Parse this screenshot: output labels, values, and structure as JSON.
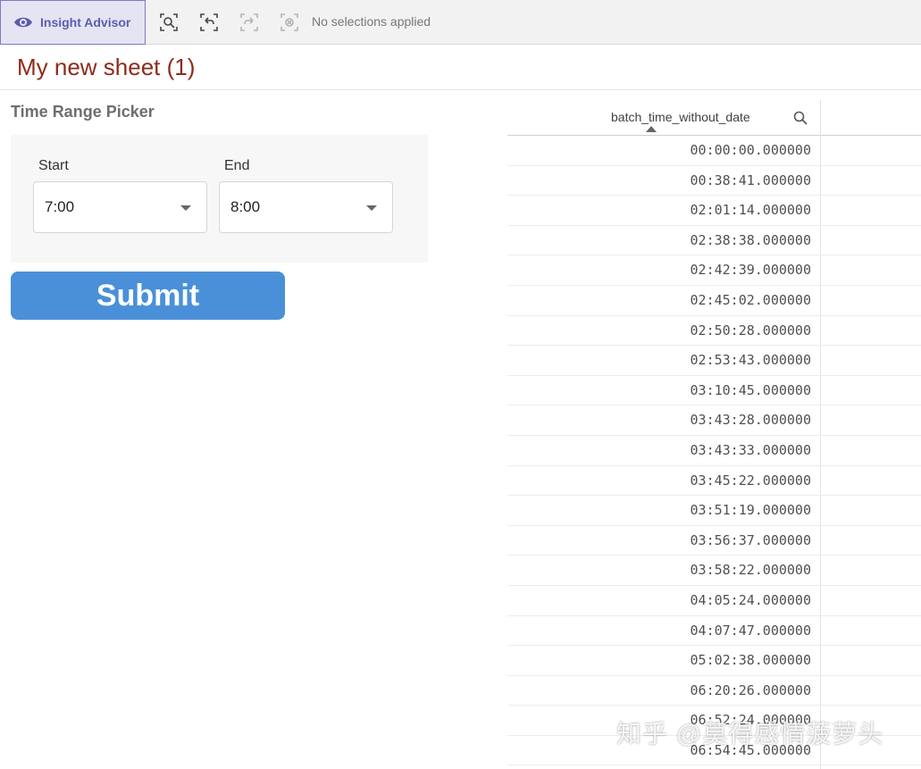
{
  "toolbar": {
    "insight_label": "Insight Advisor",
    "selection_status": "No selections applied"
  },
  "sheet": {
    "title": "My new sheet (1)"
  },
  "picker": {
    "title": "Time Range Picker",
    "start_label": "Start",
    "start_value": "7:00",
    "end_label": "End",
    "end_value": "8:00",
    "submit_label": "Submit"
  },
  "table": {
    "column_header": "batch_time_without_date",
    "rows": [
      "00:00:00.000000",
      "00:38:41.000000",
      "02:01:14.000000",
      "02:38:38.000000",
      "02:42:39.000000",
      "02:45:02.000000",
      "02:50:28.000000",
      "02:53:43.000000",
      "03:10:45.000000",
      "03:43:28.000000",
      "03:43:33.000000",
      "03:45:22.000000",
      "03:51:19.000000",
      "03:56:37.000000",
      "03:58:22.000000",
      "04:05:24.000000",
      "04:07:47.000000",
      "05:02:38.000000",
      "06:20:26.000000",
      "06:52:24.000000",
      "06:54:45.000000"
    ]
  },
  "watermark": "知乎 @莫得感情菠萝头",
  "colors": {
    "accent": "#4a90d9",
    "title": "#8d2b1c",
    "insight": "#5c5cae"
  }
}
